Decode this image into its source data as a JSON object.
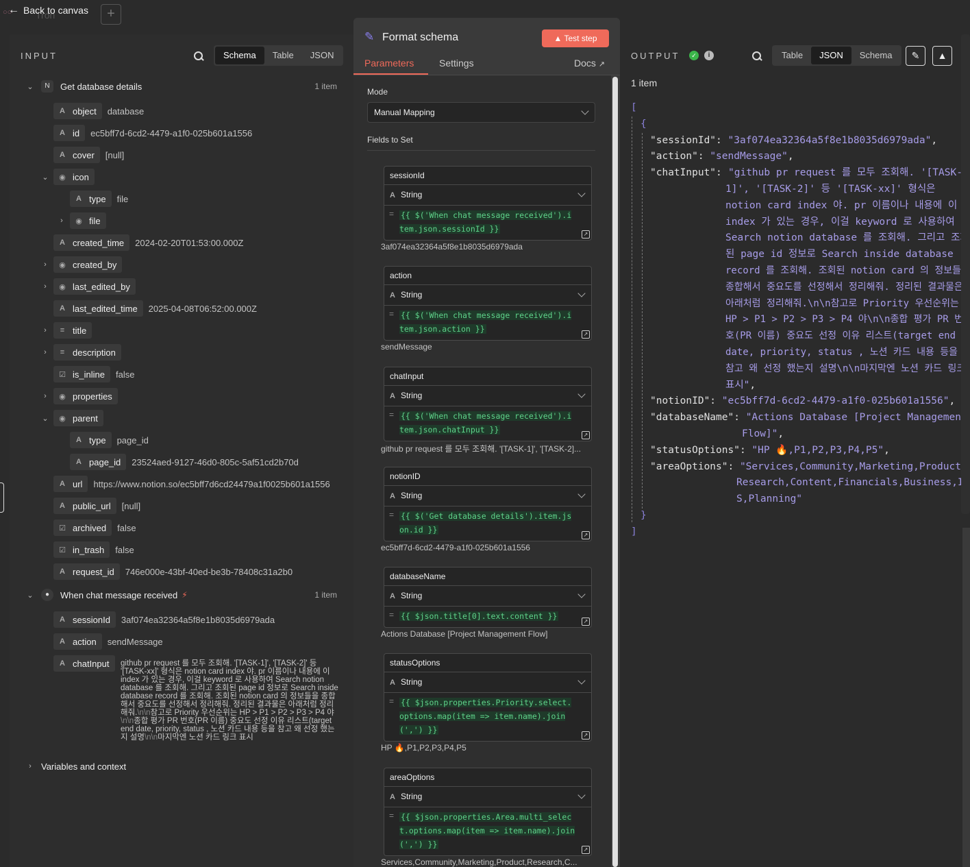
{
  "topbar": {
    "back_label": "Back to canvas",
    "ghost_text": "Tron",
    "add_icon": "plus-icon"
  },
  "input": {
    "title": "INPUT",
    "view_tabs": [
      "Schema",
      "Table",
      "JSON"
    ],
    "active_view": "Schema",
    "nodes": [
      {
        "name": "Get database details",
        "count": "1 item"
      },
      {
        "name": "When chat message received",
        "count": "1 item"
      }
    ],
    "rows": [
      {
        "key": "object",
        "value": "database"
      },
      {
        "key": "id",
        "value": "ec5bff7d-6cd2-4479-a1f0-025b601a1556"
      },
      {
        "key": "cover",
        "value": "[null]"
      },
      {
        "key": "icon",
        "value": ""
      },
      {
        "key": "type",
        "value": "file"
      },
      {
        "key": "file",
        "value": ""
      },
      {
        "key": "created_time",
        "value": "2024-02-20T01:53:00.000Z"
      },
      {
        "key": "created_by",
        "value": ""
      },
      {
        "key": "last_edited_by",
        "value": ""
      },
      {
        "key": "last_edited_time",
        "value": "2025-04-08T06:52:00.000Z"
      },
      {
        "key": "title",
        "value": ""
      },
      {
        "key": "description",
        "value": ""
      },
      {
        "key": "is_inline",
        "value": "false"
      },
      {
        "key": "properties",
        "value": ""
      },
      {
        "key": "parent",
        "value": ""
      },
      {
        "key": "type",
        "value": "page_id"
      },
      {
        "key": "page_id",
        "value": "23524aed-9127-46d0-805c-5af51cd2b70d"
      },
      {
        "key": "url",
        "value": "https://www.notion.so/ec5bff7d6cd24479a1f0025b601a1556"
      },
      {
        "key": "public_url",
        "value": "[null]"
      },
      {
        "key": "archived",
        "value": "false"
      },
      {
        "key": "in_trash",
        "value": "false"
      },
      {
        "key": "request_id",
        "value": "746e000e-43bf-40ed-be3b-78408c31a2b0"
      },
      {
        "key": "sessionId",
        "value": "3af074ea32364a5f8e1b8035d6979ada"
      },
      {
        "key": "action",
        "value": "sendMessage"
      },
      {
        "key": "chatInput",
        "value": ""
      }
    ],
    "chat_input_text_1": "github pr request 를 모두 조회해. '[TASK-1]', '[TASK-2]' 등 '[TASK-xx]' 형식은 notion card index 야. pr 이름이나 내용에 이 index 가 있는 경우, 이걸 keyword 로 사용하여 Search notion database 를 조회해. 그리고 조회된 page id 정보로 Search inside database record 를 조회해. 조회된 notion card 의 정보들을 종합해서 중요도를 선정해서 정리해줘. 정리된 결과물은 아래처럼 정리해줘.",
    "esc1": "\\n\\n",
    "chat_input_text_2": "참고로 Priority 우선순위는 HP > P1 > P2 > P3 > P4 야",
    "esc2": "\\n\\n",
    "chat_input_text_3": "종합 평가 PR 번호(PR 이름) 중요도 선정 이유 리스트(target end date, priority, status , 노션 카드 내용 등을 참고 왜 선정 했는지 설명",
    "esc3": "\\n\\n",
    "chat_input_text_4": "마지막엔 노션 카드 링크 표시",
    "variables_label": "Variables and context"
  },
  "center": {
    "title": "Format schema",
    "test_label": "Test step",
    "tabs": {
      "parameters": "Parameters",
      "settings": "Settings",
      "docs": "Docs"
    },
    "mode_label": "Mode",
    "mode_value": "Manual Mapping",
    "fields_label": "Fields to Set",
    "fields": [
      {
        "name": "sessionId",
        "type": "String",
        "expr": "{{ $('When chat message received').item.json.sessionId }}",
        "result": "3af074ea32364a5f8e1b8035d6979ada"
      },
      {
        "name": "action",
        "type": "String",
        "expr": "{{ $('When chat message received').item.json.action }}",
        "result": "sendMessage"
      },
      {
        "name": "chatInput",
        "type": "String",
        "expr": "{{ $('When chat message received').item.json.chatInput }}",
        "result": "github pr request 를 모두 조회해. '[TASK-1]', '[TASK-2]..."
      },
      {
        "name": "notionID",
        "type": "String",
        "expr": "{{ $('Get database details').item.json.id }}",
        "result": "ec5bff7d-6cd2-4479-a1f0-025b601a1556"
      },
      {
        "name": "databaseName",
        "type": "String",
        "expr": "{{ $json.title[0].text.content }}",
        "result": "Actions Database [Project Management Flow]"
      },
      {
        "name": "statusOptions",
        "type": "String",
        "expr": "{{ $json.properties.Priority.select.options.map(item => item.name).join(',') }}",
        "result": "HP 🔥,P1,P2,P3,P4,P5"
      },
      {
        "name": "areaOptions",
        "type": "String",
        "expr": "{{ $json.properties.Area.multi_select.options.map(item => item.name).join(',') }}",
        "result": "Services,Community,Marketing,Product,Research,C..."
      }
    ]
  },
  "output": {
    "title": "OUTPUT",
    "view_tabs": [
      "Table",
      "JSON",
      "Schema"
    ],
    "active_view": "JSON",
    "items_label": "1 item",
    "json": {
      "open_bracket": "[",
      "open_brace": "{",
      "close_brace": "}",
      "close_bracket": "]",
      "sessionId_key": "\"sessionId\": ",
      "sessionId_val": "\"3af074ea32364a5f8e1b8035d6979ada\"",
      "action_key": "\"action\": ",
      "action_val": "\"sendMessage\"",
      "chatInput_key": "\"chatInput\": ",
      "chatInput_lines": [
        "\"github pr request 를 모두 조회해. '[TASK-",
        "1]', '[TASK-2]' 등 '[TASK-xx]' 형식은",
        "notion card index 야. pr 이름이나 내용에 이",
        "index 가 있는 경우, 이걸 keyword 로 사용하여",
        "Search notion database 를 조회해. 그리고 조회",
        "된 page id 정보로 Search inside database",
        "record 를 조회해. 조회된 notion card 의 정보들을",
        "종합해서 중요도를 선정해서 정리해줘. 정리된 결과물은",
        "아래처럼 정리해줘.\\n\\n참고로 Priority 우선순위는",
        "HP > P1 > P2 > P3 > P4 야\\n\\n종합 평가 PR 번",
        "호(PR 이름) 중요도 선정 이유 리스트(target end",
        "date, priority, status , 노션 카드 내용 등을",
        "참고 왜 선정 했는지 설명\\n\\n마지막엔 노션 카드 링크",
        "표시\""
      ],
      "notionID_key": "\"notionID\": ",
      "notionID_val": "\"ec5bff7d-6cd2-4479-a1f0-025b601a1556\"",
      "databaseName_key": "\"databaseName\": ",
      "databaseName_val_1": "\"Actions Database [Project Management",
      "databaseName_val_2": "Flow]\"",
      "statusOptions_key": "\"statusOptions\": ",
      "statusOptions_val": "\"HP 🔥,P1,P2,P3,P4,P5\"",
      "areaOptions_key": "\"areaOptions\": ",
      "areaOptions_val_1": "\"Services,Community,Marketing,Product,",
      "areaOptions_val_2": "Research,Content,Financials,Business,IO",
      "areaOptions_val_3": "S,Planning\""
    }
  }
}
